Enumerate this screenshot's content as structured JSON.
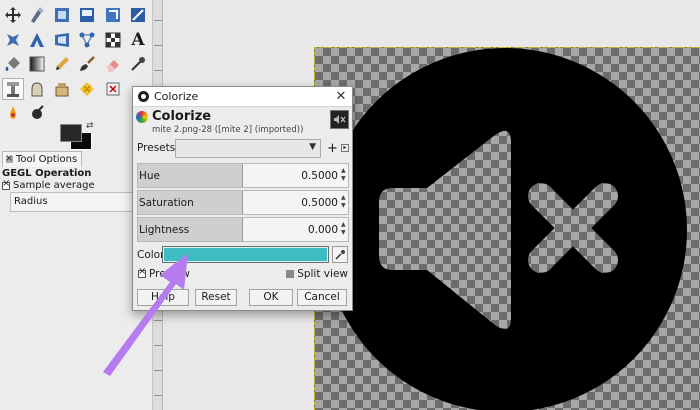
{
  "toolbox": {
    "tools": [
      "move-tool-icon",
      "warp-transform-icon",
      "scale-tool-icon",
      "align-tool-icon",
      "crop-tool-icon",
      "unified-transform-icon",
      "perspective-icon",
      "free-select-icon",
      "paths-tool-icon",
      "text-tool-icon-2",
      "handle-transform-icon",
      "checker-icon",
      "text-tool-icon",
      "",
      "bucket-fill-icon",
      "gradient-icon",
      "pencil-icon",
      "paintbrush-icon",
      "eraser-icon",
      "color-picker-icon",
      "",
      "measure-icon",
      "fuzzy-select-icon",
      "clone-icon",
      "smudge-icon",
      "",
      "",
      "",
      "heal-icon",
      "ink-icon"
    ],
    "text_tool_glyph": "A",
    "tool_options_tab": "Tool Options",
    "gegl_title": "GEGL Operation",
    "sample_average": "Sample average",
    "radius_label": "Radius"
  },
  "dialog": {
    "window_title": "Colorize",
    "header_title": "Colorize",
    "header_subtitle": "mite 2.png-28 ([mite 2] (imported))",
    "presets_label": "Presets:",
    "presets_value": "",
    "sliders": [
      {
        "label": "Hue",
        "value": "0.5000",
        "fraction": 0.5
      },
      {
        "label": "Saturation",
        "value": "0.5000",
        "fraction": 0.5
      },
      {
        "label": "Lightness",
        "value": "0.000",
        "fraction": 0.5
      }
    ],
    "color_label": "Color",
    "color_value": "#3dbcc2",
    "preview_label": "Preview",
    "split_view_label": "Split view",
    "buttons": {
      "help": "Help",
      "reset": "Reset",
      "ok": "OK",
      "cancel": "Cancel"
    }
  },
  "colors": {
    "arrow": "#b57cf0",
    "selected_color": "#3dbcc2"
  }
}
